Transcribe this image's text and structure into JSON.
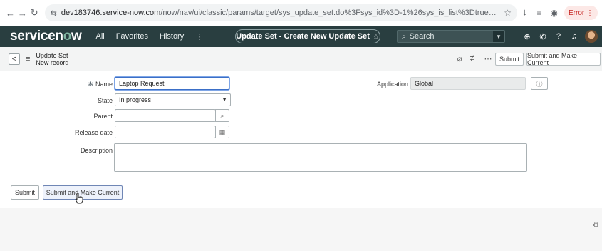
{
  "browser": {
    "url_host": "dev183746.service-now.com",
    "url_rest": "/now/nav/ui/classic/params/target/sys_update_set.do%3Fsys_id%3D-1%26sys_is_list%3Dtrue%26sys_target%3Dsys_update_set...",
    "error_badge": "Error"
  },
  "header": {
    "logo_text_pre": "servicen",
    "logo_text_o": "o",
    "logo_text_post": "w",
    "nav": {
      "all": "All",
      "favorites": "Favorites",
      "history": "History",
      "more": "⋮"
    },
    "page_title": "Update Set - Create New Update Set",
    "search_placeholder": "Search"
  },
  "titlebar": {
    "record_type": "Update Set",
    "record_state": "New record",
    "submit_label": "Submit",
    "submit_make_current_label": "Submit and Make Current"
  },
  "form": {
    "name": {
      "label": "Name",
      "value": "Laptop Request"
    },
    "state": {
      "label": "State",
      "value": "In progress"
    },
    "parent": {
      "label": "Parent",
      "value": ""
    },
    "release_date": {
      "label": "Release date",
      "value": ""
    },
    "description": {
      "label": "Description",
      "value": ""
    },
    "application": {
      "label": "Application",
      "value": "Global"
    }
  },
  "bottom": {
    "submit_label": "Submit",
    "submit_make_current_label": "Submit and Make Current"
  }
}
